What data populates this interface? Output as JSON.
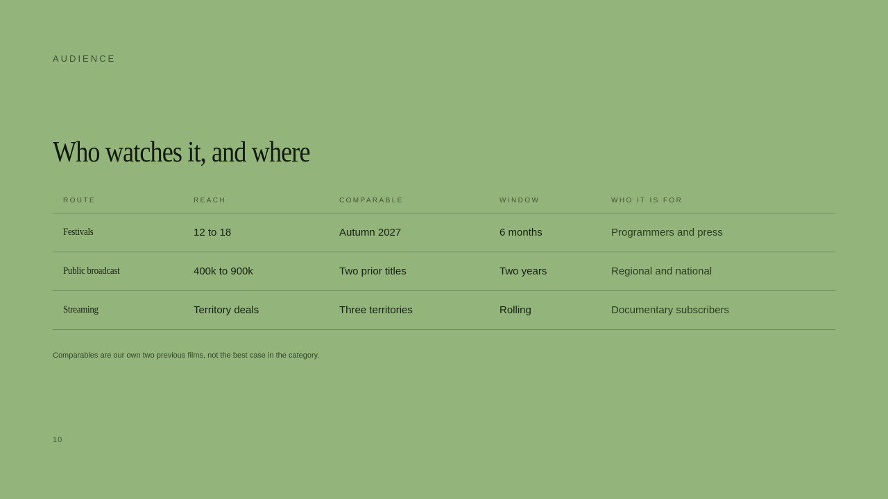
{
  "slide": {
    "eyebrow": "AUDIENCE",
    "title": "Who watches it, and where",
    "note": "Comparables are our own two previous films, not the best case in the category.",
    "page_number": "10"
  },
  "table": {
    "headers": [
      "ROUTE",
      "REACH",
      "COMPARABLE",
      "WINDOW",
      "WHO IT IS FOR"
    ],
    "rows": [
      [
        "Festivals",
        "12 to 18",
        "Autumn 2027",
        "6 months",
        "Programmers and press"
      ],
      [
        "Public broadcast",
        "400k to 900k",
        "Two prior titles",
        "Two years",
        "Regional and national"
      ],
      [
        "Streaming",
        "Territory deals",
        "Three territories",
        "Rolling",
        "Documentary subscribers"
      ]
    ]
  }
}
